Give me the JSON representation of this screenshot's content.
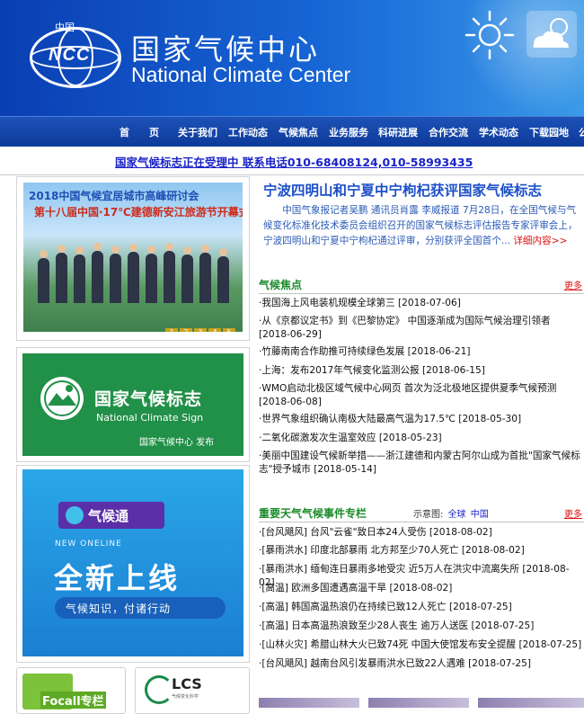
{
  "header": {
    "logo_cn": "中国",
    "logo_abbr": "NCC",
    "title_cn": "国家气候中心",
    "title_en": "National Climate Center"
  },
  "nav": {
    "items": [
      "首　　页",
      "关于我们",
      "工作动态",
      "气候焦点",
      "业务服务",
      "科研进展",
      "合作交流",
      "学术动态",
      "下载园地",
      "公"
    ]
  },
  "notice": {
    "text": "国家气候标志正在受理中 联系电话010-68408124,010-58993435"
  },
  "left": {
    "banner1": {
      "title": "2018中国气候宜居城市高峰研讨会",
      "subtitle": "第十八届中国·17℃建德新安江旅游节开幕式",
      "pager": [
        "1",
        "2",
        "3",
        "4",
        "5"
      ]
    },
    "banner2": {
      "title_cn": "国家气候标志",
      "title_en": "National Climate Sign",
      "publisher": "国家气候中心 发布"
    },
    "banner3": {
      "app_name": "气候通",
      "tag": "NEW ONELINE",
      "headline": "全新上线",
      "slogan": "气候知识，付诸行动"
    },
    "tiles": {
      "focus": "Focall专栏",
      "lcs_title": "LCS",
      "lcs_sub": "气候变化科学"
    }
  },
  "main": {
    "headline": "宁波四明山和宁夏中宁枸杞获评国家气候标志",
    "summary": "中国气象报记者吴鹏 通讯员肖露 李威报道 7月28日，在全国气候与气候变化标准化技术委员会组织召开的国家气候标志评估报告专家评审会上，宁波四明山和宁夏中宁枸杞通过评审，分别获评全国首个...",
    "summary_more": "详细内容>>",
    "focus": {
      "title": "气候焦点",
      "more": "更多",
      "items": [
        "·我国海上风电装机规模全球第三 [2018-07-06]",
        "·从《京都议定书》到《巴黎协定》 中国逐渐成为国际气候治理引领者 [2018-06-29]",
        "·竹藤南南合作助推可持续绿色发展 [2018-06-21]",
        "·上海：发布2017年气候变化监测公报 [2018-06-15]",
        "·WMO启动北极区域气候中心网页 首次为泛北极地区提供夏季气候预测 [2018-06-08]",
        "·世界气象组织确认南极大陆最高气温为17.5℃ [2018-05-30]",
        "·二氧化碳激发次生温室效应 [2018-05-23]",
        "·美丽中国建设气候新举措——浙江建德和内蒙古阿尔山成为首批\"国家气候标志\"授予城市 [2018-05-14]"
      ]
    },
    "events": {
      "title": "重要天气气候事件专栏",
      "legend_label": "示意图:",
      "legend_links": [
        "全球",
        "中国"
      ],
      "more": "更多",
      "items": [
        "·[台风飓风] 台风\"云雀\"致日本24人受伤 [2018-08-02]",
        "·[暴雨洪水] 印度北部暴雨 北方邦至少70人死亡 [2018-08-02]",
        "·[暴雨洪水] 缅甸连日暴雨多地受灾 近5万人在洪灾中流离失所 [2018-08-02]",
        "·[高温] 欧洲多国遭遇高温干旱 [2018-08-02]",
        "·[高温] 韩国高温热浪仍在持续已致12人死亡 [2018-07-25]",
        "·[高温] 日本高温热浪致至少28人丧生 逾万人送医 [2018-07-25]",
        "·[山林火灾] 希腊山林大火已致74死 中国大使馆发布安全提醒 [2018-07-25]",
        "·[台风飓风] 越南台风引发暴雨洪水已致22人遇难 [2018-07-25]"
      ]
    }
  },
  "colors": {
    "header_blue": "#0a3fb3",
    "link_blue": "#1a23c8",
    "section_green": "#1a8b2a",
    "more_red": "#dd1111"
  }
}
